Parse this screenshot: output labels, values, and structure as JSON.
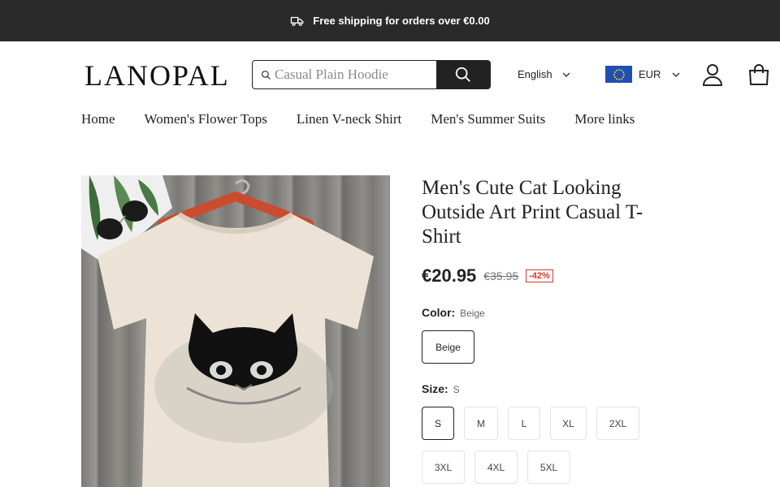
{
  "announcement": {
    "text": "Free shipping for orders over €0.00",
    "icon": "truck-icon"
  },
  "header": {
    "logo": "LANOPAL",
    "search": {
      "placeholder": "Casual Plain Hoodie",
      "icon": "search-icon"
    },
    "language": "English",
    "currency": "EUR",
    "icons": [
      "account-icon",
      "cart-icon"
    ]
  },
  "nav": {
    "items": [
      "Home",
      "Women's Flower Tops",
      "Linen V-neck Shirt",
      "Men's Summer Suits",
      "More links"
    ]
  },
  "product": {
    "title": "Men's Cute Cat Looking Outside Art Print Casual T-Shirt",
    "price": "€20.95",
    "compare_price": "€35.95",
    "discount": "-42%",
    "color": {
      "label": "Color:",
      "selected": "Beige",
      "options": [
        "Beige"
      ]
    },
    "size": {
      "label": "Size:",
      "selected": "S",
      "options": [
        "S",
        "M",
        "L",
        "XL",
        "2XL",
        "3XL",
        "4XL",
        "5XL"
      ]
    }
  },
  "colors": {
    "topbar": "#2a2a2a",
    "accent_dark": "#222222",
    "discount": "#d43a2c",
    "shirt": "#ece3d6"
  }
}
